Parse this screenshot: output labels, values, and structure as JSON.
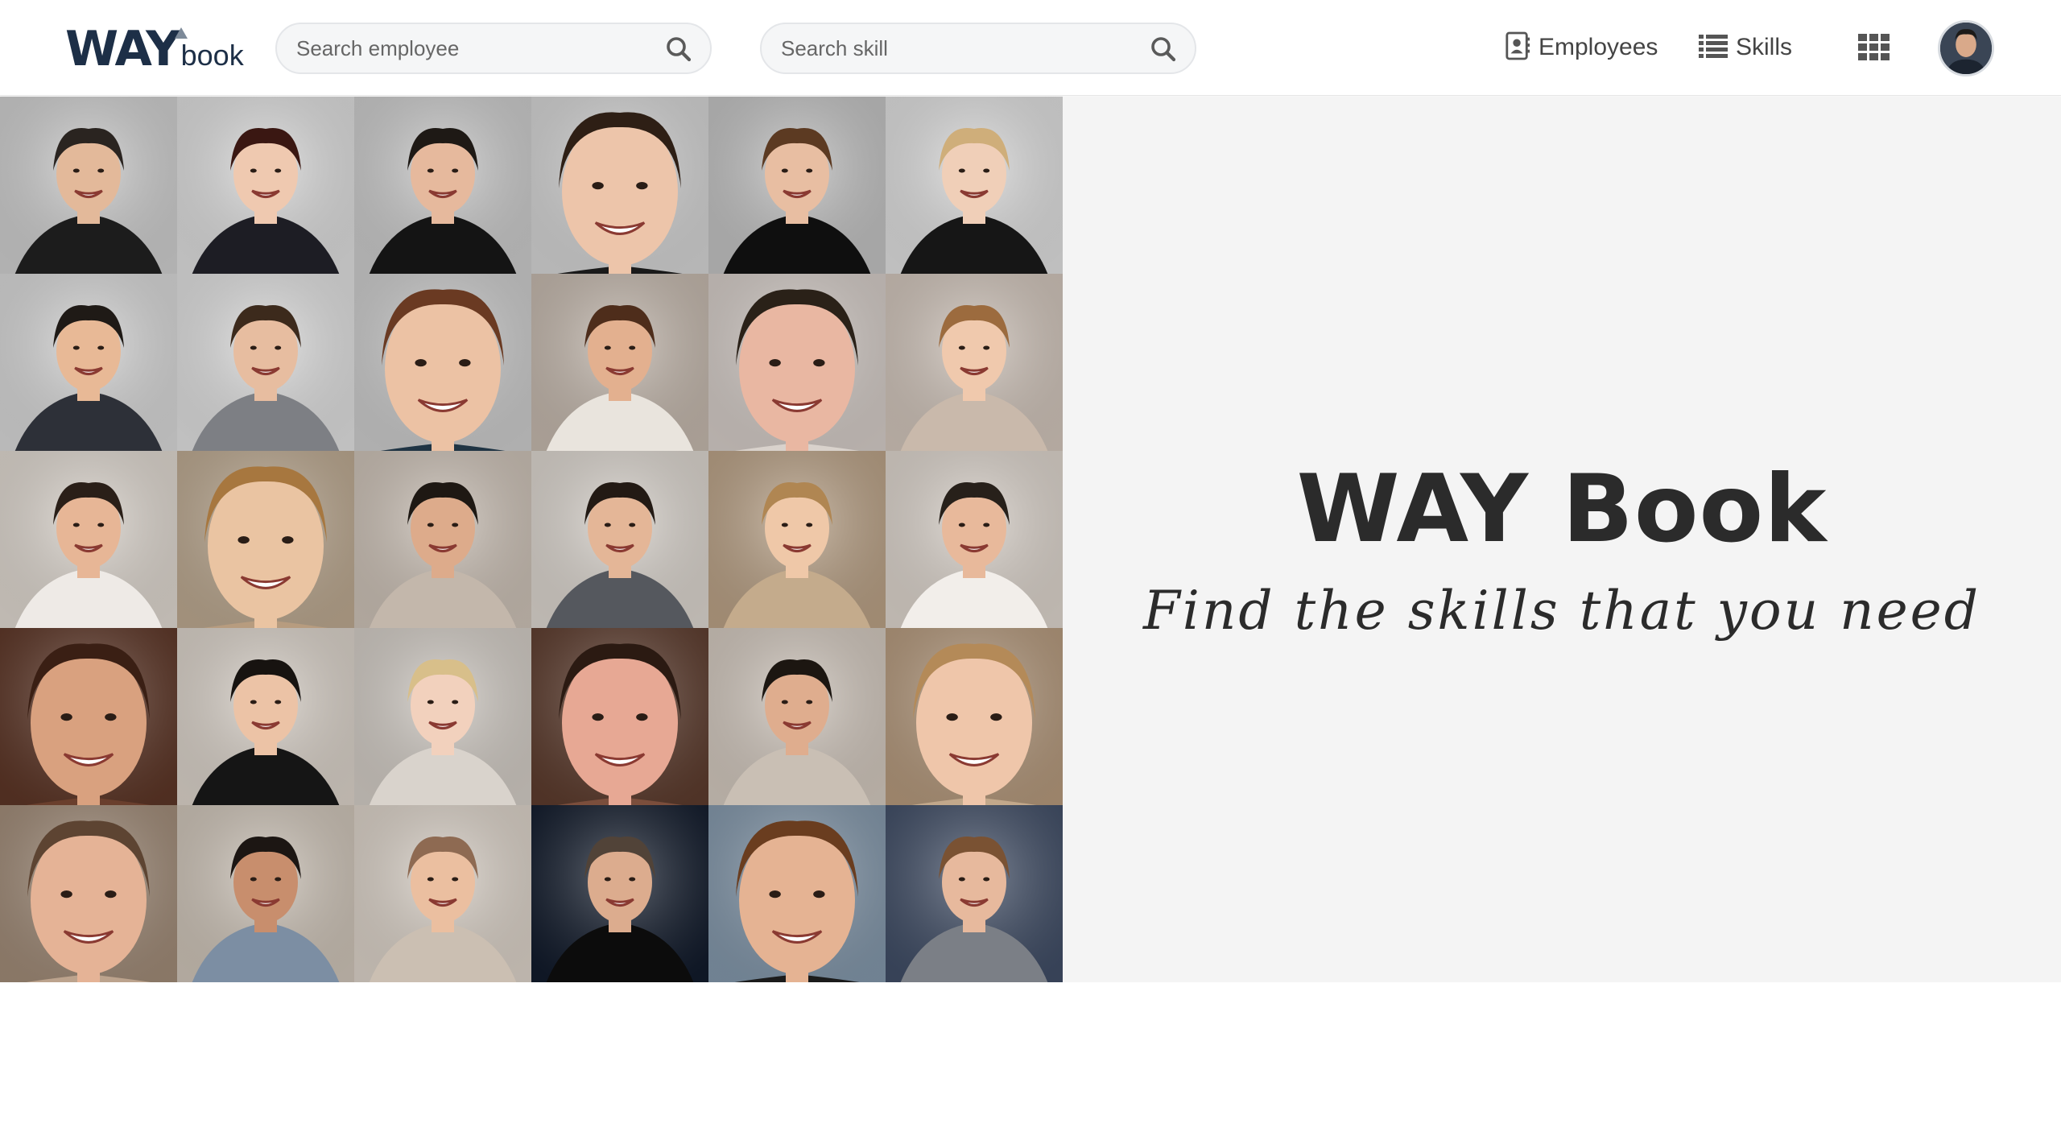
{
  "header": {
    "logo": {
      "way": "WAY",
      "book": "book"
    },
    "employee_search": {
      "placeholder": "Search employee",
      "icon": "search-icon"
    },
    "skill_search": {
      "placeholder": "Search skill",
      "icon": "search-icon"
    },
    "nav": [
      {
        "label": "Employees",
        "icon": "contact-card-icon"
      },
      {
        "label": "Skills",
        "icon": "list-icon"
      }
    ],
    "apps_icon": "grid-icon",
    "user_avatar": "user-avatar"
  },
  "hero": {
    "title": "WAY Book",
    "subtitle": "Find the skills that you need"
  },
  "photo_grid": {
    "rows": 5,
    "columns": 6,
    "photos": [
      {
        "bg": "#c9c9c9",
        "skin": "#e3b99a",
        "hair": "#2a2420",
        "cloth": "#1c1c1c"
      },
      {
        "bg": "#d8d8d8",
        "skin": "#efc9b0",
        "hair": "#3a1712",
        "cloth": "#1d1d24"
      },
      {
        "bg": "#c6c6c6",
        "skin": "#e6b99d",
        "hair": "#1e1915",
        "cloth": "#141414"
      },
      {
        "bg": "#cfcfcf",
        "skin": "#edc5aa",
        "hair": "#2e1f15",
        "cloth": "#1a1a1a"
      },
      {
        "bg": "#bdbdbd",
        "skin": "#e8bea2",
        "hair": "#5c3a22",
        "cloth": "#0f0f0f"
      },
      {
        "bg": "#d9d9d9",
        "skin": "#f0cfb8",
        "hair": "#cfae7a",
        "cloth": "#161616"
      },
      {
        "bg": "#d2d2d2",
        "skin": "#e8b996",
        "hair": "#1f1a16",
        "cloth": "#2d3038"
      },
      {
        "bg": "#dadada",
        "skin": "#e7bda0",
        "hair": "#3c2a1c",
        "cloth": "#7d7f84"
      },
      {
        "bg": "#c7c7c7",
        "skin": "#ecc2a4",
        "hair": "#6a3a22",
        "cloth": "#1f3444"
      },
      {
        "bg": "#bfb3a8",
        "skin": "#e3b08f",
        "hair": "#4e2d1b",
        "cloth": "#e9e4dd"
      },
      {
        "bg": "#cfc7c2",
        "skin": "#e9b7a2",
        "hair": "#2a2118",
        "cloth": "#d9d2cc"
      },
      {
        "bg": "#cbbfb5",
        "skin": "#f0c9ad",
        "hair": "#9c6b3e",
        "cloth": "#c9b9ab"
      },
      {
        "bg": "#d9d2ca",
        "skin": "#e7b696",
        "hair": "#2a1f18",
        "cloth": "#eeeae6"
      },
      {
        "bg": "#b7a48c",
        "skin": "#eac4a2",
        "hair": "#a7773f",
        "cloth": "#b79c7f"
      },
      {
        "bg": "#c7bcb1",
        "skin": "#ddab8b",
        "hair": "#1e1813",
        "cloth": "#c3b7ab"
      },
      {
        "bg": "#d6d0c9",
        "skin": "#e4b697",
        "hair": "#231a14",
        "cloth": "#55585e"
      },
      {
        "bg": "#b59d82",
        "skin": "#efc8a8",
        "hair": "#b08652",
        "cloth": "#c4ab8c"
      },
      {
        "bg": "#d7cfc7",
        "skin": "#e8b99b",
        "hair": "#27201a",
        "cloth": "#f2eeea"
      },
      {
        "bg": "#5a3425",
        "skin": "#d9a17f",
        "hair": "#3a1f14",
        "cloth": "#6a3f2d"
      },
      {
        "bg": "#d5cdc4",
        "skin": "#ecc3a6",
        "hair": "#171310",
        "cloth": "#151515"
      },
      {
        "bg": "#cdc7c0",
        "skin": "#f2d1bd",
        "hair": "#d8bf8a",
        "cloth": "#d9d3cc"
      },
      {
        "bg": "#5a3a2c",
        "skin": "#e7a894",
        "hair": "#2b1a12",
        "cloth": "#7b4e3c"
      },
      {
        "bg": "#cdc3b9",
        "skin": "#dfad8e",
        "hair": "#1c1611",
        "cloth": "#c9bfb4"
      },
      {
        "bg": "#b09579",
        "skin": "#efc6aa",
        "hair": "#b48a58",
        "cloth": "#c2a88b"
      },
      {
        "bg": "#9c8774",
        "skin": "#e5b396",
        "hair": "#5d4432",
        "cloth": "#bca38d"
      },
      {
        "bg": "#c9bfb3",
        "skin": "#c88e6d",
        "hair": "#1c1613",
        "cloth": "#7c8ea3"
      },
      {
        "bg": "#d6cdc3",
        "skin": "#ebbfa0",
        "hair": "#8e6a52",
        "cloth": "#cbbfb2"
      },
      {
        "bg": "#111a2a",
        "skin": "#dcac8e",
        "hair": "#514338",
        "cloth": "#0c0c0c"
      },
      {
        "bg": "#7f93a6",
        "skin": "#e5b393",
        "hair": "#6a3d1f",
        "cloth": "#1b1b1b"
      },
      {
        "bg": "#3e4b63",
        "skin": "#e7b99d",
        "hair": "#7a5233",
        "cloth": "#7b7f86"
      }
    ]
  },
  "colors": {
    "brand_navy": "#1d2f47",
    "hero_bg": "#f4f4f4",
    "hero_text": "#2b2b2b"
  }
}
